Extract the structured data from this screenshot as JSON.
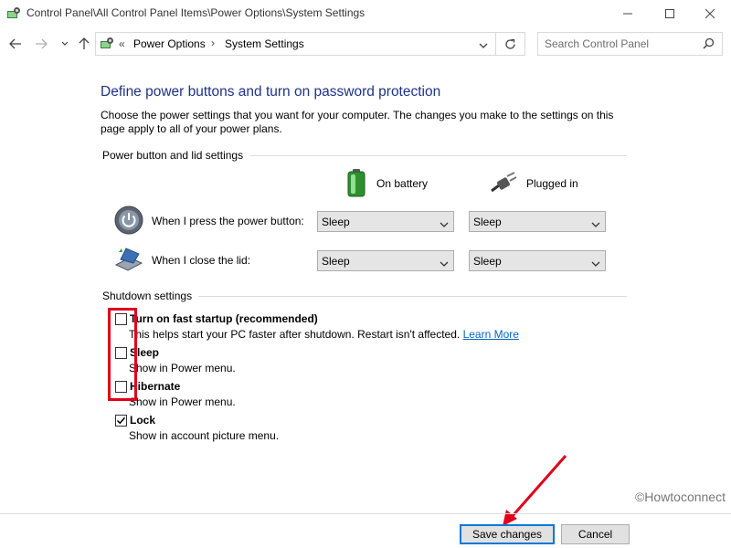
{
  "window": {
    "title": "Control Panel\\All Control Panel Items\\Power Options\\System Settings"
  },
  "nav": {
    "breadcrumb_sep": "«",
    "crumbs": [
      "Power Options",
      "System Settings"
    ],
    "crumb_arrow": "›",
    "search_placeholder": "Search Control Panel"
  },
  "page": {
    "title": "Define power buttons and turn on password protection",
    "description": "Choose the power settings that you want for your computer. The changes you make to the settings on this page apply to all of your power plans."
  },
  "power_group": {
    "heading": "Power button and lid settings",
    "columns": [
      "On battery",
      "Plugged in"
    ],
    "rows": [
      {
        "label": "When I press the power button:",
        "on_battery": "Sleep",
        "plugged_in": "Sleep"
      },
      {
        "label": "When I close the lid:",
        "on_battery": "Sleep",
        "plugged_in": "Sleep"
      }
    ]
  },
  "shutdown_group": {
    "heading": "Shutdown settings",
    "options": [
      {
        "title": "Turn on fast startup (recommended)",
        "description": "This helps start your PC faster after shutdown. Restart isn't affected.",
        "link": "Learn More",
        "checked": false
      },
      {
        "title": "Sleep",
        "description": "Show in Power menu.",
        "checked": false
      },
      {
        "title": "Hibernate",
        "description": "Show in Power menu.",
        "checked": false
      },
      {
        "title": "Lock",
        "description": "Show in account picture menu.",
        "checked": true
      }
    ]
  },
  "footer": {
    "watermark": "©Howtoconnect",
    "save_label": "Save changes",
    "cancel_label": "Cancel"
  },
  "colors": {
    "title_blue": "#1e3287",
    "link_blue": "#0066cc",
    "highlight_red": "#e0001b",
    "primary_border": "#0078d7"
  }
}
